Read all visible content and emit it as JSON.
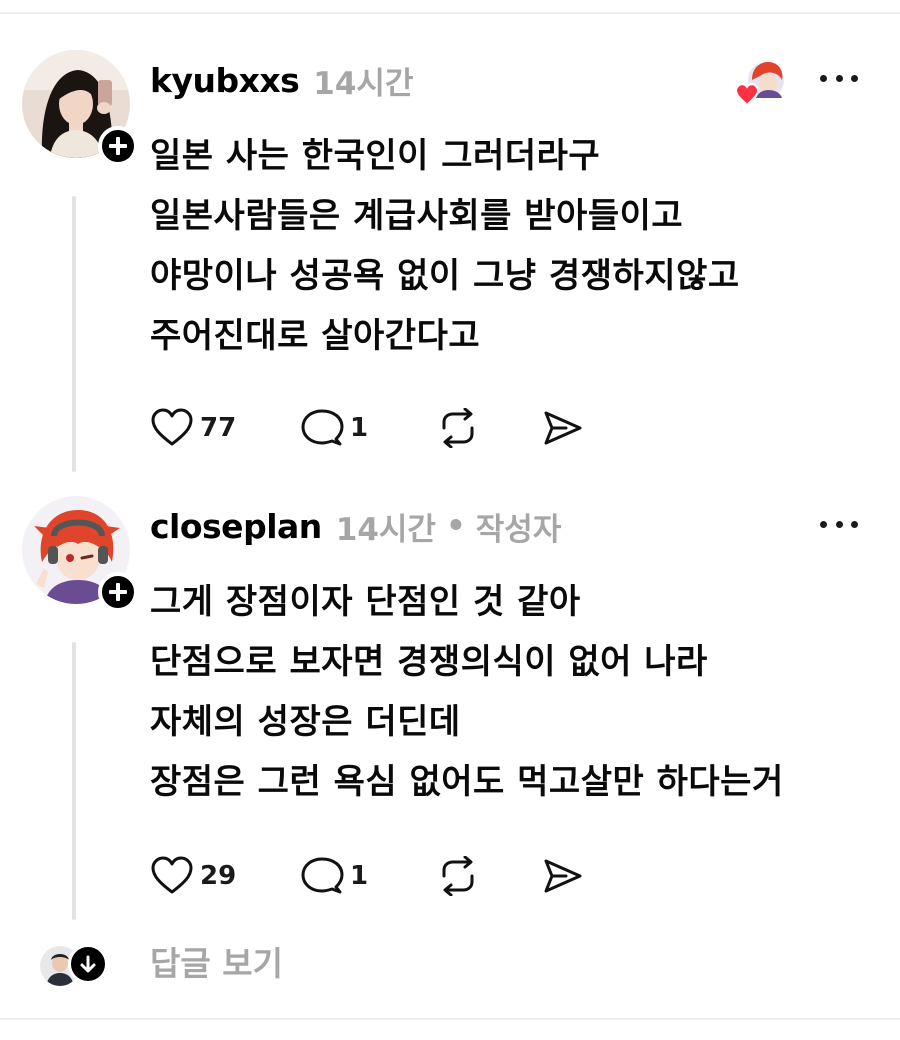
{
  "posts": [
    {
      "username": "kyubxxs",
      "time": "14시간",
      "author_tag": "",
      "lines": [
        "일본 사는 한국인이 그러더라구",
        "일본사람들은 계급사회를 받아들이고",
        "야망이나 성공욕 없이 그냥 경쟁하지않고",
        "주어진대로 살아간다고"
      ],
      "likes": "77",
      "comments": "1"
    },
    {
      "username": "closeplan",
      "time": "14시간",
      "separator": "•",
      "author_tag": "작성자",
      "lines": [
        "그게 장점이자 단점인 것 같아",
        "단점으로 보자면 경쟁의식이 없어 나라",
        "자체의 성장은 더딘데",
        "장점은 그런 욕심 없어도 먹고살만 하다는거"
      ],
      "likes": "29",
      "comments": "1"
    }
  ],
  "view_replies_label": "답글 보기",
  "icons": {
    "like": "heart-icon",
    "comment": "comment-bubble-icon",
    "repost": "repost-icon",
    "share": "send-icon",
    "more": "more-dots-icon",
    "follow": "plus-icon",
    "expand": "arrow-down-icon"
  },
  "colors": {
    "text": "#000000",
    "muted": "#a6a6a6",
    "heart_badge": "#ff3040",
    "thread_line": "#e2e2e2"
  }
}
